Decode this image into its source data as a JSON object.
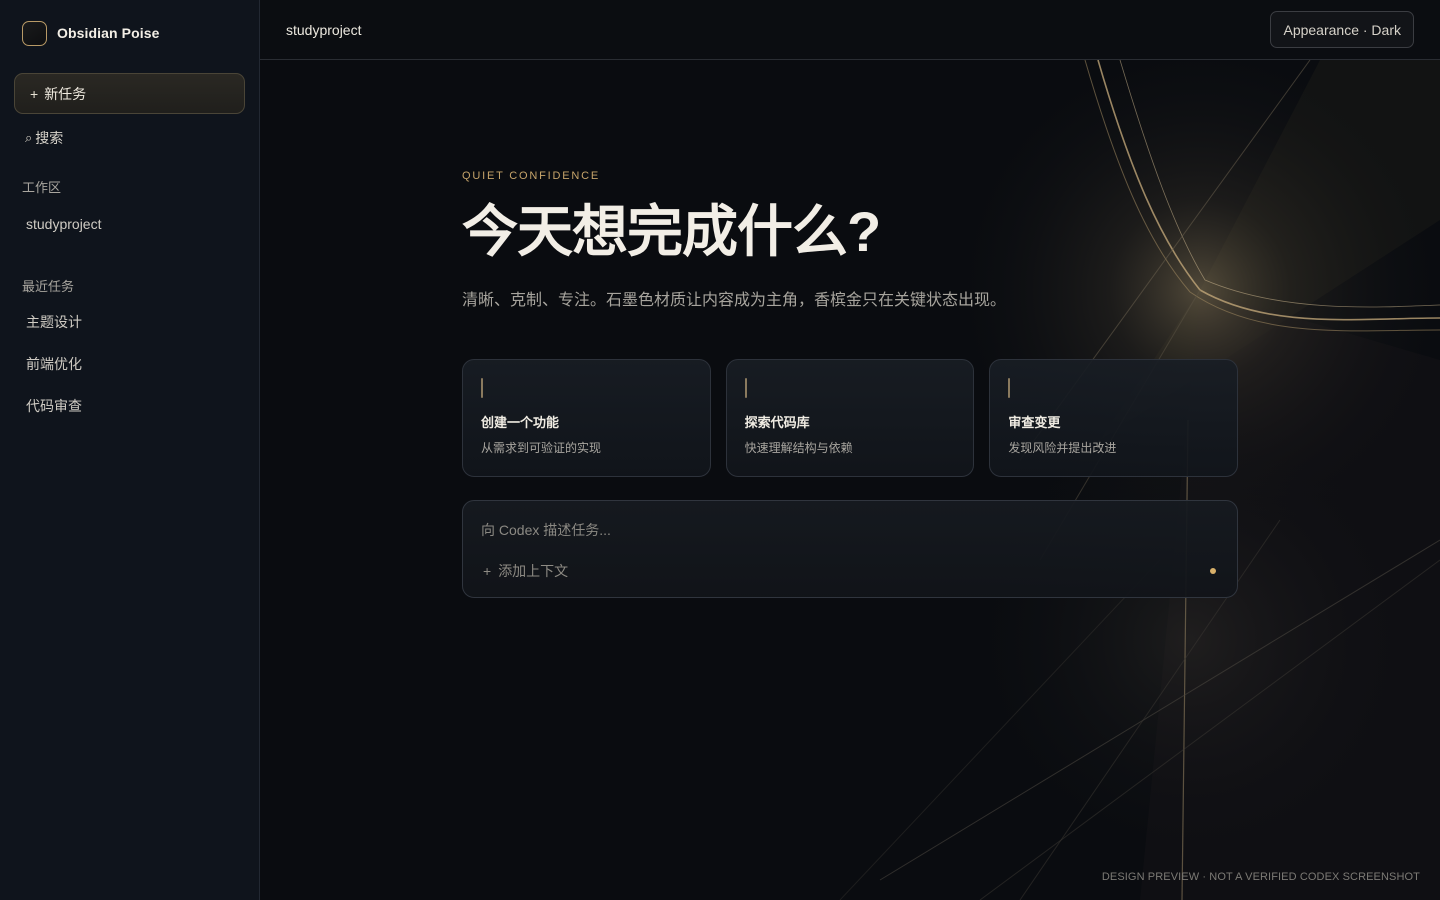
{
  "sidebar": {
    "brand": "Obsidian Poise",
    "new_task_plus": "+",
    "new_task": "新任务",
    "search_icon": "⌕",
    "search": "搜索",
    "workspace_label": "工作区",
    "workspace_items": [
      {
        "label": "studyproject"
      }
    ],
    "recent_label": "最近任务",
    "recent_items": [
      {
        "label": "主题设计"
      },
      {
        "label": "前端优化"
      },
      {
        "label": "代码审查"
      }
    ]
  },
  "topbar": {
    "project": "studyproject",
    "appearance": "Appearance · Dark"
  },
  "hero": {
    "eyebrow": "QUIET CONFIDENCE",
    "headline": "今天想完成什么?",
    "subtitle": "清晰、克制、专注。石墨色材质让内容成为主角，香槟金只在关键状态出现。"
  },
  "cards": [
    {
      "title": "创建一个功能",
      "desc": "从需求到可验证的实现"
    },
    {
      "title": "探索代码库",
      "desc": "快速理解结构与依赖"
    },
    {
      "title": "审查变更",
      "desc": "发现风险并提出改进"
    }
  ],
  "composer": {
    "placeholder": "向 Codex 描述任务...",
    "add_context_plus": "+",
    "add_context": "添加上下文"
  },
  "footer": {
    "note": "DESIGN PREVIEW · NOT A VERIFIED CODEX SCREENSHOT"
  },
  "colors": {
    "accent_gold": "#c6a46a",
    "background": "#0a0c10",
    "sidebar": "#0f141c"
  }
}
